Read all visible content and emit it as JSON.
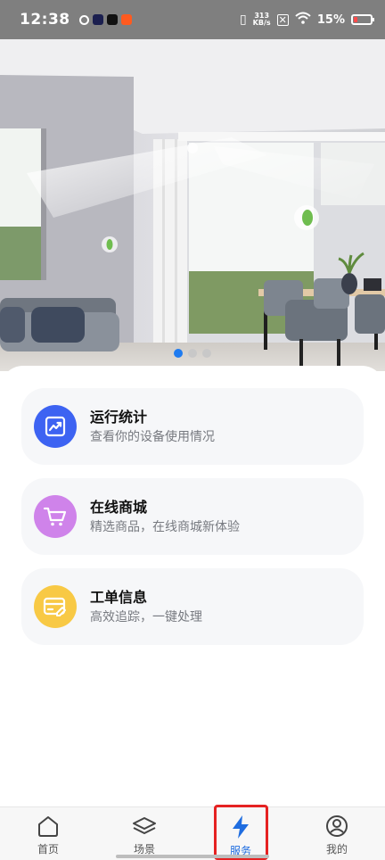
{
  "status_bar": {
    "time": "12:38",
    "net_speed_value": "313",
    "net_speed_unit": "KB/s",
    "battery": "15%"
  },
  "banner": {
    "dots": [
      true,
      false,
      false
    ]
  },
  "cards": [
    {
      "title": "运行统计",
      "subtitle": "查看你的设备使用情况",
      "icon": "chart-icon",
      "color": "#3d63f2"
    },
    {
      "title": "在线商城",
      "subtitle": "精选商品，在线商城新体验",
      "icon": "cart-icon",
      "color": "#cf83ea"
    },
    {
      "title": "工单信息",
      "subtitle": "高效追踪，一键处理",
      "icon": "card-edit-icon",
      "color": "#f8c945"
    }
  ],
  "nav": {
    "items": [
      {
        "label": "首页",
        "icon": "home-icon"
      },
      {
        "label": "场景",
        "icon": "layers-icon"
      },
      {
        "label": "服务",
        "icon": "bolt-icon",
        "active": true
      },
      {
        "label": "我的",
        "icon": "user-icon"
      }
    ],
    "active_color": "#1f6de0"
  }
}
